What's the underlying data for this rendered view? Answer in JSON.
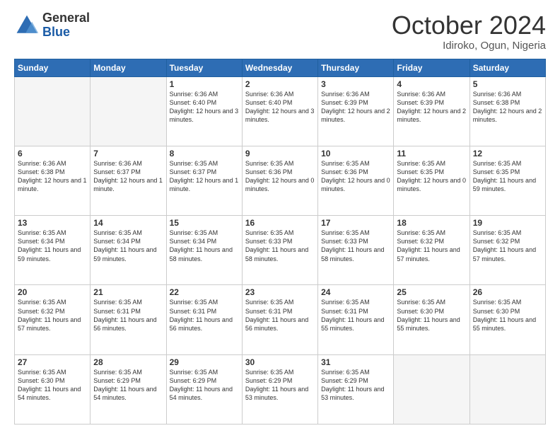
{
  "header": {
    "logo_general": "General",
    "logo_blue": "Blue",
    "month_title": "October 2024",
    "location": "Idiroko, Ogun, Nigeria"
  },
  "weekdays": [
    "Sunday",
    "Monday",
    "Tuesday",
    "Wednesday",
    "Thursday",
    "Friday",
    "Saturday"
  ],
  "weeks": [
    [
      {
        "day": "",
        "sunrise": "",
        "sunset": "",
        "daylight": ""
      },
      {
        "day": "",
        "sunrise": "",
        "sunset": "",
        "daylight": ""
      },
      {
        "day": "1",
        "sunrise": "Sunrise: 6:36 AM",
        "sunset": "Sunset: 6:40 PM",
        "daylight": "Daylight: 12 hours and 3 minutes."
      },
      {
        "day": "2",
        "sunrise": "Sunrise: 6:36 AM",
        "sunset": "Sunset: 6:40 PM",
        "daylight": "Daylight: 12 hours and 3 minutes."
      },
      {
        "day": "3",
        "sunrise": "Sunrise: 6:36 AM",
        "sunset": "Sunset: 6:39 PM",
        "daylight": "Daylight: 12 hours and 2 minutes."
      },
      {
        "day": "4",
        "sunrise": "Sunrise: 6:36 AM",
        "sunset": "Sunset: 6:39 PM",
        "daylight": "Daylight: 12 hours and 2 minutes."
      },
      {
        "day": "5",
        "sunrise": "Sunrise: 6:36 AM",
        "sunset": "Sunset: 6:38 PM",
        "daylight": "Daylight: 12 hours and 2 minutes."
      }
    ],
    [
      {
        "day": "6",
        "sunrise": "Sunrise: 6:36 AM",
        "sunset": "Sunset: 6:38 PM",
        "daylight": "Daylight: 12 hours and 1 minute."
      },
      {
        "day": "7",
        "sunrise": "Sunrise: 6:36 AM",
        "sunset": "Sunset: 6:37 PM",
        "daylight": "Daylight: 12 hours and 1 minute."
      },
      {
        "day": "8",
        "sunrise": "Sunrise: 6:35 AM",
        "sunset": "Sunset: 6:37 PM",
        "daylight": "Daylight: 12 hours and 1 minute."
      },
      {
        "day": "9",
        "sunrise": "Sunrise: 6:35 AM",
        "sunset": "Sunset: 6:36 PM",
        "daylight": "Daylight: 12 hours and 0 minutes."
      },
      {
        "day": "10",
        "sunrise": "Sunrise: 6:35 AM",
        "sunset": "Sunset: 6:36 PM",
        "daylight": "Daylight: 12 hours and 0 minutes."
      },
      {
        "day": "11",
        "sunrise": "Sunrise: 6:35 AM",
        "sunset": "Sunset: 6:35 PM",
        "daylight": "Daylight: 12 hours and 0 minutes."
      },
      {
        "day": "12",
        "sunrise": "Sunrise: 6:35 AM",
        "sunset": "Sunset: 6:35 PM",
        "daylight": "Daylight: 11 hours and 59 minutes."
      }
    ],
    [
      {
        "day": "13",
        "sunrise": "Sunrise: 6:35 AM",
        "sunset": "Sunset: 6:34 PM",
        "daylight": "Daylight: 11 hours and 59 minutes."
      },
      {
        "day": "14",
        "sunrise": "Sunrise: 6:35 AM",
        "sunset": "Sunset: 6:34 PM",
        "daylight": "Daylight: 11 hours and 59 minutes."
      },
      {
        "day": "15",
        "sunrise": "Sunrise: 6:35 AM",
        "sunset": "Sunset: 6:34 PM",
        "daylight": "Daylight: 11 hours and 58 minutes."
      },
      {
        "day": "16",
        "sunrise": "Sunrise: 6:35 AM",
        "sunset": "Sunset: 6:33 PM",
        "daylight": "Daylight: 11 hours and 58 minutes."
      },
      {
        "day": "17",
        "sunrise": "Sunrise: 6:35 AM",
        "sunset": "Sunset: 6:33 PM",
        "daylight": "Daylight: 11 hours and 58 minutes."
      },
      {
        "day": "18",
        "sunrise": "Sunrise: 6:35 AM",
        "sunset": "Sunset: 6:32 PM",
        "daylight": "Daylight: 11 hours and 57 minutes."
      },
      {
        "day": "19",
        "sunrise": "Sunrise: 6:35 AM",
        "sunset": "Sunset: 6:32 PM",
        "daylight": "Daylight: 11 hours and 57 minutes."
      }
    ],
    [
      {
        "day": "20",
        "sunrise": "Sunrise: 6:35 AM",
        "sunset": "Sunset: 6:32 PM",
        "daylight": "Daylight: 11 hours and 57 minutes."
      },
      {
        "day": "21",
        "sunrise": "Sunrise: 6:35 AM",
        "sunset": "Sunset: 6:31 PM",
        "daylight": "Daylight: 11 hours and 56 minutes."
      },
      {
        "day": "22",
        "sunrise": "Sunrise: 6:35 AM",
        "sunset": "Sunset: 6:31 PM",
        "daylight": "Daylight: 11 hours and 56 minutes."
      },
      {
        "day": "23",
        "sunrise": "Sunrise: 6:35 AM",
        "sunset": "Sunset: 6:31 PM",
        "daylight": "Daylight: 11 hours and 56 minutes."
      },
      {
        "day": "24",
        "sunrise": "Sunrise: 6:35 AM",
        "sunset": "Sunset: 6:31 PM",
        "daylight": "Daylight: 11 hours and 55 minutes."
      },
      {
        "day": "25",
        "sunrise": "Sunrise: 6:35 AM",
        "sunset": "Sunset: 6:30 PM",
        "daylight": "Daylight: 11 hours and 55 minutes."
      },
      {
        "day": "26",
        "sunrise": "Sunrise: 6:35 AM",
        "sunset": "Sunset: 6:30 PM",
        "daylight": "Daylight: 11 hours and 55 minutes."
      }
    ],
    [
      {
        "day": "27",
        "sunrise": "Sunrise: 6:35 AM",
        "sunset": "Sunset: 6:30 PM",
        "daylight": "Daylight: 11 hours and 54 minutes."
      },
      {
        "day": "28",
        "sunrise": "Sunrise: 6:35 AM",
        "sunset": "Sunset: 6:29 PM",
        "daylight": "Daylight: 11 hours and 54 minutes."
      },
      {
        "day": "29",
        "sunrise": "Sunrise: 6:35 AM",
        "sunset": "Sunset: 6:29 PM",
        "daylight": "Daylight: 11 hours and 54 minutes."
      },
      {
        "day": "30",
        "sunrise": "Sunrise: 6:35 AM",
        "sunset": "Sunset: 6:29 PM",
        "daylight": "Daylight: 11 hours and 53 minutes."
      },
      {
        "day": "31",
        "sunrise": "Sunrise: 6:35 AM",
        "sunset": "Sunset: 6:29 PM",
        "daylight": "Daylight: 11 hours and 53 minutes."
      },
      {
        "day": "",
        "sunrise": "",
        "sunset": "",
        "daylight": ""
      },
      {
        "day": "",
        "sunrise": "",
        "sunset": "",
        "daylight": ""
      }
    ]
  ]
}
